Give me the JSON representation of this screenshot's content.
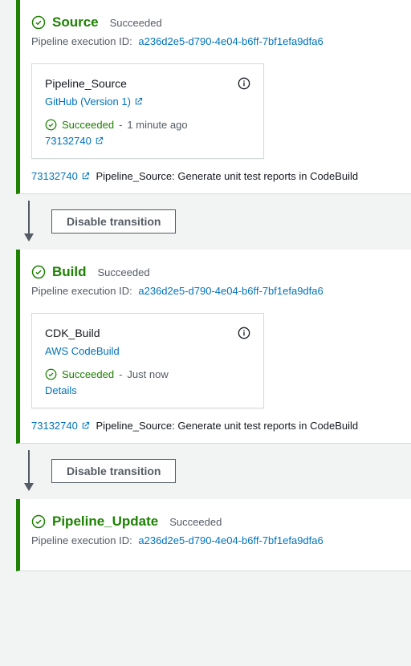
{
  "colors": {
    "success": "#1d8102",
    "link": "#0073bb"
  },
  "common": {
    "exec_label": "Pipeline execution ID:",
    "exec_id": "a236d2e5-d790-4e04-b6ff-7bf1efa9dfa6",
    "succeeded": "Succeeded",
    "disable_transition": "Disable transition",
    "commit_sha": "73132740",
    "commit_message": "Pipeline_Source: Generate unit test reports in CodeBuild"
  },
  "stages": {
    "source": {
      "title": "Source",
      "status": "Succeeded",
      "action": {
        "name": "Pipeline_Source",
        "provider": "GitHub (Version 1)",
        "status": "Succeeded",
        "time": "1 minute ago",
        "commit": "73132740"
      }
    },
    "build": {
      "title": "Build",
      "status": "Succeeded",
      "action": {
        "name": "CDK_Build",
        "provider": "AWS CodeBuild",
        "status": "Succeeded",
        "time": "Just now",
        "details": "Details"
      }
    },
    "pipeline_update": {
      "title": "Pipeline_Update",
      "status": "Succeeded"
    }
  }
}
